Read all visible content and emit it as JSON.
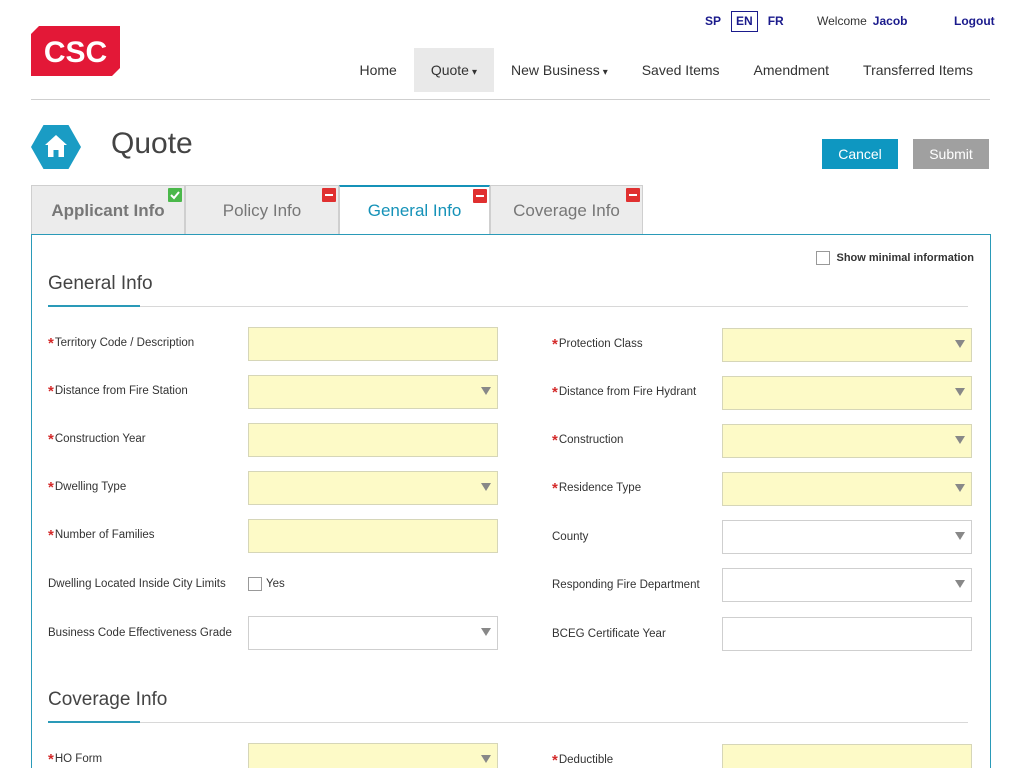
{
  "brand": {
    "logo_text": "CSC",
    "color": "#e31837"
  },
  "languages": [
    {
      "code": "SP",
      "active": false
    },
    {
      "code": "EN",
      "active": true
    },
    {
      "code": "FR",
      "active": false
    }
  ],
  "user": {
    "welcome_label": "Welcome",
    "name": "Jacob",
    "logout_label": "Logout"
  },
  "nav": {
    "items": [
      {
        "label": "Home",
        "caret": ""
      },
      {
        "label": "Quote",
        "caret": "▾"
      },
      {
        "label": "New Business",
        "caret": "▾"
      },
      {
        "label": "Saved Items",
        "caret": ""
      },
      {
        "label": "Amendment",
        "caret": ""
      },
      {
        "label": "Transferred Items",
        "caret": ""
      }
    ],
    "active_index": 1
  },
  "page": {
    "title": "Quote",
    "home_icon": "home-icon"
  },
  "actions": {
    "cancel_label": "Cancel",
    "submit_label": "Submit"
  },
  "tabs": [
    {
      "label": "Applicant Info",
      "status": "complete",
      "status_icon": "check-icon"
    },
    {
      "label": "Policy Info",
      "status": "incomplete",
      "status_icon": "minus-icon"
    },
    {
      "label": "General Info",
      "status": "incomplete",
      "status_icon": "minus-icon"
    },
    {
      "label": "Coverage Info",
      "status": "incomplete",
      "status_icon": "minus-icon"
    }
  ],
  "active_tab_index": 2,
  "panel": {
    "minimal_label": "Show minimal information",
    "general": {
      "title": "General Info",
      "fields": {
        "territory": {
          "label": "Territory Code / Description",
          "required": "*"
        },
        "protection_class": {
          "label": "Protection Class",
          "required": "*"
        },
        "distance_station": {
          "label": "Distance from Fire Station",
          "required": "*"
        },
        "distance_hydrant": {
          "label": "Distance from Fire Hydrant",
          "required": "*"
        },
        "construction_year": {
          "label": "Construction Year",
          "required": "*"
        },
        "construction": {
          "label": "Construction",
          "required": "*"
        },
        "dwelling_type": {
          "label": "Dwelling Type",
          "required": "*"
        },
        "residence_type": {
          "label": "Residence Type",
          "required": "*"
        },
        "number_families": {
          "label": "Number of Families",
          "required": "*"
        },
        "county": {
          "label": "County"
        },
        "city_limits": {
          "label": "Dwelling Located Inside City Limits",
          "checkbox_label": "Yes"
        },
        "fire_department": {
          "label": "Responding Fire Department"
        },
        "bceg_grade": {
          "label": "Business Code Effectiveness Grade"
        },
        "bceg_year": {
          "label": "BCEG Certificate Year"
        }
      }
    },
    "coverage": {
      "title": "Coverage Info",
      "fields": {
        "ho_form": {
          "label": "HO Form",
          "required": "*"
        },
        "deductible": {
          "label": "Deductible",
          "required": "*"
        }
      }
    }
  },
  "colors": {
    "accent": "#0e97c1",
    "required_field_bg": "#fdfac7",
    "submit_disabled": "#a0a0a0"
  }
}
